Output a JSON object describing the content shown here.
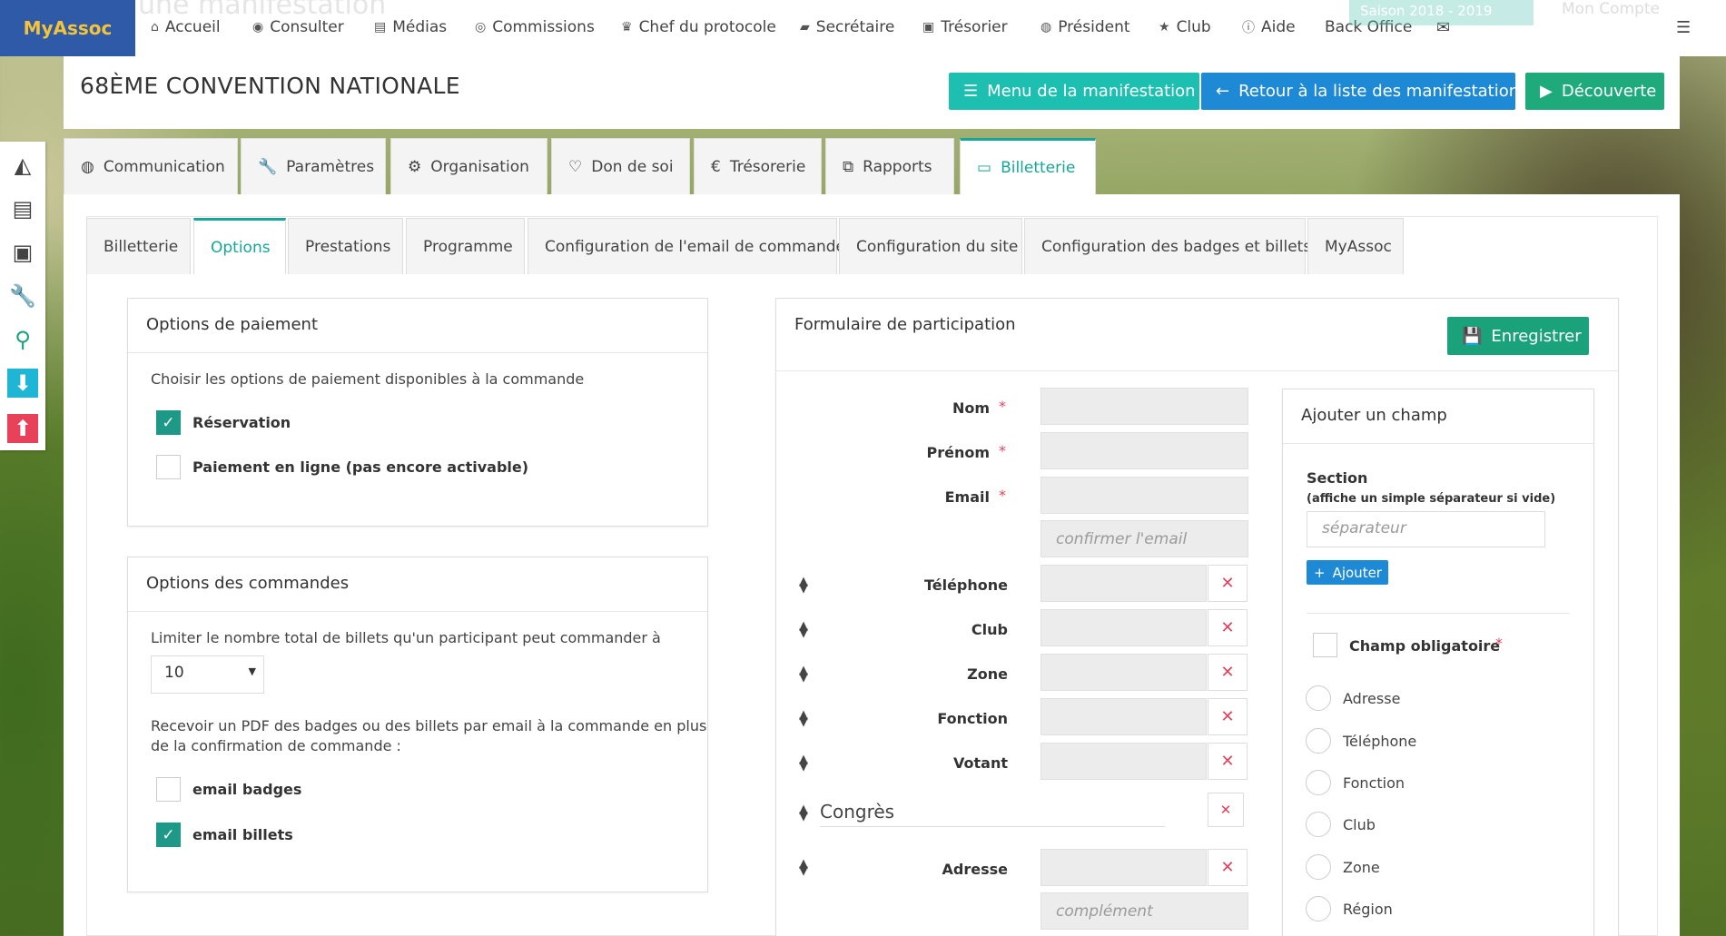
{
  "app": {
    "logo": "MyAssoc",
    "ghost_title": "une manifestation",
    "ghost_select": "Saison 2018 - 2019",
    "ghost_account": "Mon Compte"
  },
  "nav": [
    {
      "icon": "home-icon",
      "glyph": "⌂",
      "label": "Accueil"
    },
    {
      "icon": "eye-icon",
      "glyph": "◉",
      "label": "Consulter"
    },
    {
      "icon": "file-icon",
      "glyph": "▤",
      "label": "Médias"
    },
    {
      "icon": "users-circle-icon",
      "glyph": "◎",
      "label": "Commissions"
    },
    {
      "icon": "trophy-icon",
      "glyph": "♛",
      "label": "Chef du protocole"
    },
    {
      "icon": "book-icon",
      "glyph": "▰",
      "label": "Secrétaire"
    },
    {
      "icon": "money-icon",
      "glyph": "▣",
      "label": "Trésorier"
    },
    {
      "icon": "globe-icon",
      "glyph": "◍",
      "label": "Président"
    },
    {
      "icon": "star-icon",
      "glyph": "★",
      "label": "Club"
    },
    {
      "icon": "info-icon",
      "glyph": "ⓘ",
      "label": "Aide"
    },
    {
      "icon": "",
      "glyph": "",
      "label": "Back Office"
    }
  ],
  "header": {
    "title": "68ÈME CONVENTION NATIONALE",
    "btn_menu": "Menu de la manifestation",
    "btn_back": "Retour à la liste des manifestations",
    "btn_discover": "Découverte"
  },
  "main_tabs": [
    {
      "icon": "globe-icon",
      "glyph": "◍",
      "label": "Communication"
    },
    {
      "icon": "wrench-icon",
      "glyph": "🔧",
      "label": "Paramètres"
    },
    {
      "icon": "cogs-icon",
      "glyph": "⚙",
      "label": "Organisation"
    },
    {
      "icon": "heart-icon",
      "glyph": "♡",
      "label": "Don de soi"
    },
    {
      "icon": "euro-icon",
      "glyph": "€",
      "label": "Trésorerie"
    },
    {
      "icon": "copy-icon",
      "glyph": "⧉",
      "label": "Rapports"
    },
    {
      "icon": "credit-card-icon",
      "glyph": "▭",
      "label": "Billetterie"
    }
  ],
  "sub_tabs": [
    "Billetterie",
    "Options",
    "Prestations",
    "Programme",
    "Configuration de l'email de commande",
    "Configuration du site",
    "Configuration des badges et billets",
    "MyAssoc"
  ],
  "payment": {
    "title": "Options de paiement",
    "desc": "Choisir les options de paiement disponibles à la commande",
    "opt1": "Réservation",
    "opt2": "Paiement en ligne (pas encore activable)"
  },
  "orders": {
    "title": "Options des commandes",
    "limit_text": "Limiter le nombre total de billets qu'un participant peut commander à",
    "limit_value": "10",
    "pdf_text_1": "Recevoir un PDF des badges ou des billets par email à la commande en plus",
    "pdf_text_2": "de la confirmation de commande :",
    "opt_badges": "email badges",
    "opt_billets": "email billets"
  },
  "form": {
    "title": "Formulaire de participation",
    "save": "Enregistrer",
    "fields": {
      "nom": "Nom",
      "prenom": "Prénom",
      "email": "Email",
      "confirm_ph": "confirmer l'email",
      "telephone": "Téléphone",
      "club": "Club",
      "zone": "Zone",
      "fonction": "Fonction",
      "votant": "Votant",
      "section": "Congrès",
      "adresse": "Adresse",
      "complement_ph": "complément"
    }
  },
  "add_field": {
    "title": "Ajouter un champ",
    "section_label": "Section",
    "section_hint": "(affiche un simple séparateur si vide)",
    "section_ph": "séparateur",
    "add_btn": "Ajouter",
    "required": "Champ obligatoire",
    "options": [
      "Adresse",
      "Téléphone",
      "Fonction",
      "Club",
      "Zone",
      "Région"
    ]
  }
}
